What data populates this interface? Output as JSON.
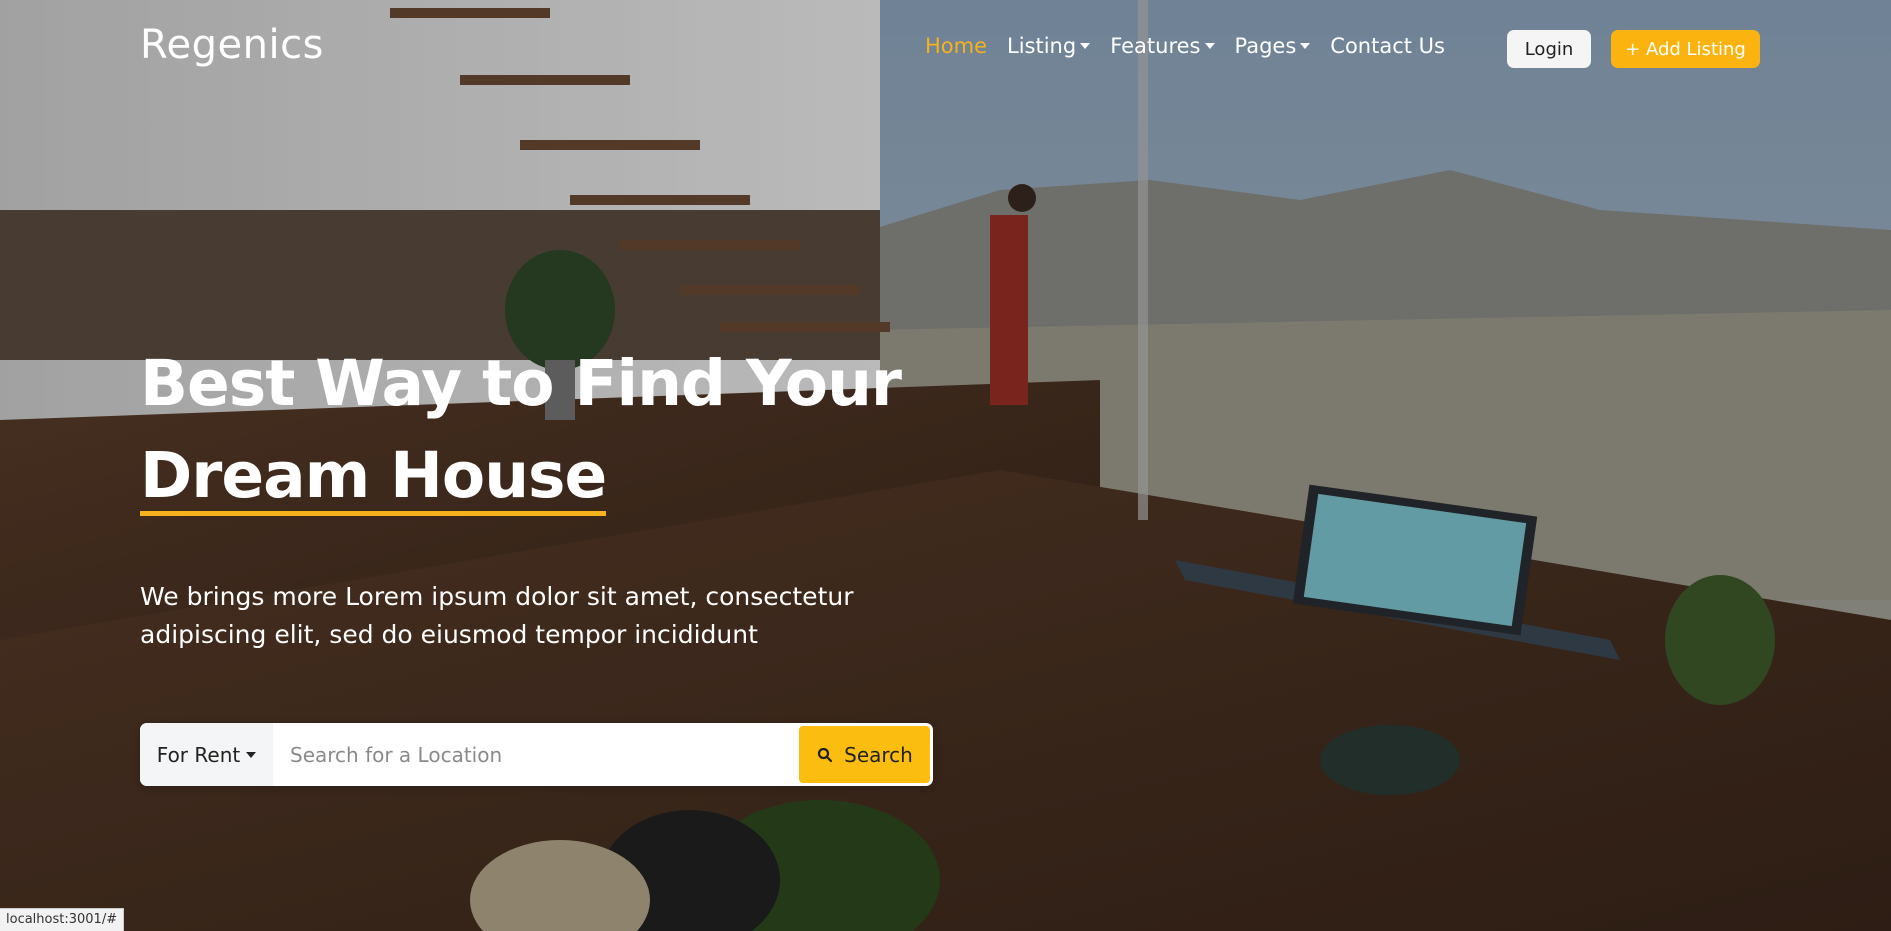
{
  "brand": {
    "name": "Regenics"
  },
  "nav": {
    "items": [
      {
        "label": "Home",
        "active": true,
        "dropdown": false
      },
      {
        "label": "Listing",
        "active": false,
        "dropdown": true
      },
      {
        "label": "Features",
        "active": false,
        "dropdown": true
      },
      {
        "label": "Pages",
        "active": false,
        "dropdown": true
      },
      {
        "label": "Contact Us",
        "active": false,
        "dropdown": false
      }
    ],
    "login_label": "Login",
    "add_listing_label": "+ Add Listing"
  },
  "hero": {
    "title_line1": "Best Way to Find Your",
    "title_line2": "Dream House",
    "subtitle": "We brings more Lorem ipsum dolor sit amet, consectetur adipiscing elit, sed do eiusmod tempor incididunt"
  },
  "search": {
    "type_selected": "For Rent",
    "placeholder": "Search for a Location",
    "value": "",
    "button_label": "Search"
  },
  "status_bar": {
    "url": "localhost:3001/#"
  },
  "colors": {
    "accent": "#fbb40f",
    "active_nav": "#f6b21c",
    "search_button": "#fbbe10"
  }
}
